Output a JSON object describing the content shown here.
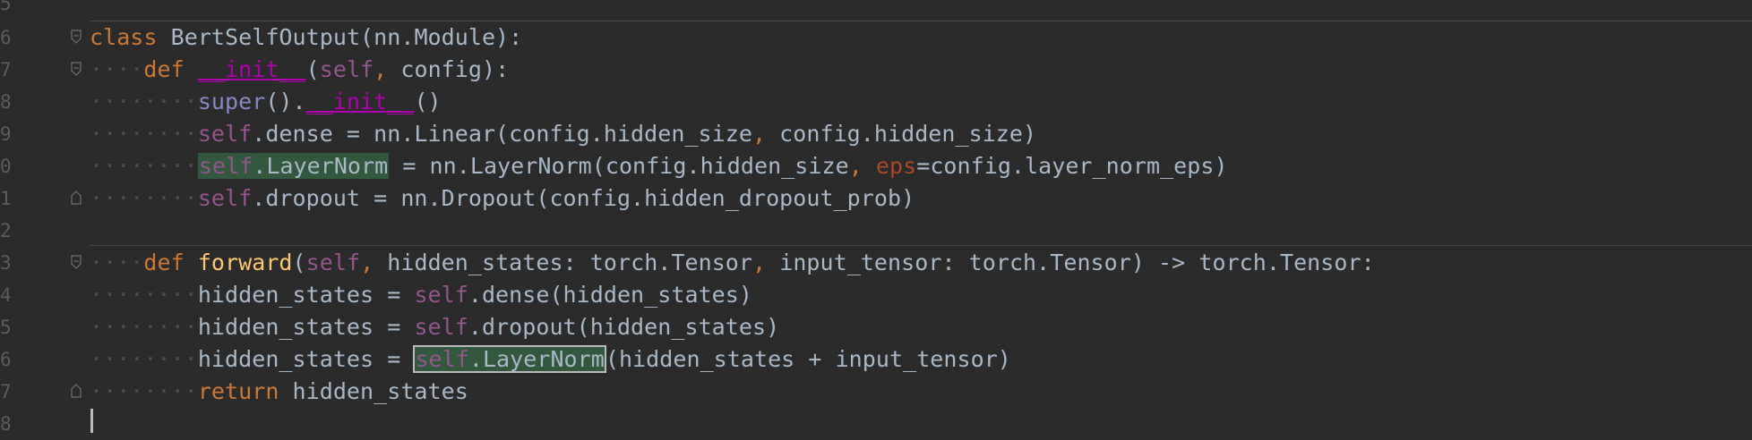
{
  "editor": {
    "language": "python",
    "colors": {
      "background": "#2b2b2b",
      "default_text": "#a9b7c6",
      "keyword": "#cc7832",
      "self": "#94558d",
      "function_name": "#ffc66d",
      "builtin": "#8888c6",
      "magic_method": "#b200b2",
      "named_param": "#aa4926",
      "highlight": "#32593d",
      "line_number": "#5a5d60"
    },
    "line_numbers": [
      "5",
      "6",
      "7",
      "8",
      "9",
      "0",
      "1",
      "2",
      "3",
      "4",
      "5",
      "6",
      "7",
      "8"
    ],
    "fold_icons": {
      "fold_class": "fold-collapse-icon",
      "fold_init": "fold-collapse-icon",
      "fold_init_end": "fold-end-icon",
      "fold_forward": "fold-collapse-icon",
      "fold_forward_end": "fold-end-icon"
    },
    "lines": {
      "l6": {
        "kw": "class",
        "name": "BertSelfOutput",
        "rest": "(nn.Module):"
      },
      "l7": {
        "kw": "def",
        "name": "__init__",
        "p1": "(",
        "self": "self",
        "comma": ",",
        "rest": " config):"
      },
      "l8": {
        "builtin": "super",
        "mid": "().",
        "magic": "__init__",
        "rest": "()"
      },
      "l9": {
        "self": "self",
        "a": ".dense = nn.Linear(config.hidden_size",
        "comma": ",",
        "b": " config.hidden_size)"
      },
      "l10": {
        "self": "self",
        "attr": ".LayerNorm",
        "a": " = nn.LayerNorm(config.hidden_size",
        "comma": ",",
        "param": "eps",
        "b": "=config.layer_norm_eps)"
      },
      "l11": {
        "self": "self",
        "a": ".dropout = nn.Dropout(config.hidden_dropout_prob)"
      },
      "l13": {
        "kw": "def",
        "name": "forward",
        "p1": "(",
        "self": "self",
        "comma1": ",",
        "a": " hidden_states: torch.Tensor",
        "comma2": ",",
        "b": " input_tensor: torch.Tensor) -> torch.Tensor:"
      },
      "l14": {
        "a": "hidden_states = ",
        "self": "self",
        "b": ".dense(hidden_states)"
      },
      "l15": {
        "a": "hidden_states = ",
        "self": "self",
        "b": ".dropout(hidden_states)"
      },
      "l16": {
        "a": "hidden_states = ",
        "self": "self",
        "attr": ".LayerNorm",
        "b": "(hidden_states + input_tensor)"
      },
      "l17": {
        "kw": "return",
        "b": " hidden_states"
      }
    }
  }
}
